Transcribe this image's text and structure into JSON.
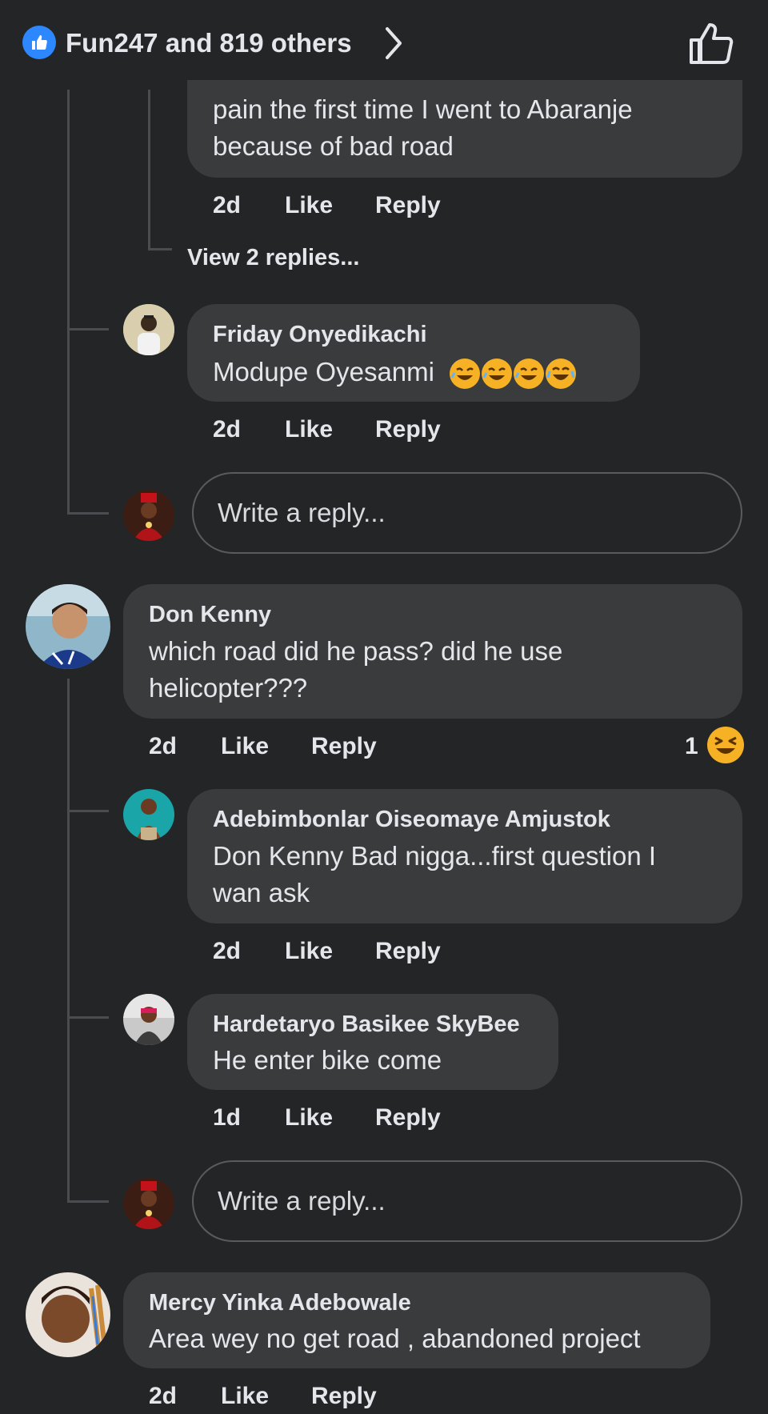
{
  "header": {
    "reactors_text": "Fun247 and 819 others",
    "like_icon": "thumbs-up-icon",
    "chevron_icon": "chevron-right-icon",
    "like_button_icon": "thumbs-up-outline-icon"
  },
  "colors": {
    "background": "#242526",
    "bubble": "#3a3b3c",
    "accent": "#2d88ff",
    "text": "#e4e6eb"
  },
  "partial_comment": {
    "text": "pain the first time I went to Abaranje because of bad road",
    "time": "2d",
    "like": "Like",
    "reply": "Reply",
    "view_replies": "View 2 replies..."
  },
  "reply_friday": {
    "name": "Friday Onyedikachi",
    "text": "Modupe Oyesanmi",
    "emojis": [
      "rolling-laughing-emoji",
      "rolling-laughing-emoji",
      "rolling-laughing-emoji",
      "tears-of-joy-emoji"
    ],
    "time": "2d",
    "like": "Like",
    "reply": "Reply"
  },
  "reply_box_1": {
    "placeholder": "Write a reply..."
  },
  "comment_don": {
    "name": "Don Kenny",
    "text": "which road did he pass? did he use helicopter???",
    "time": "2d",
    "like": "Like",
    "reply": "Reply",
    "reaction_count": "1",
    "reaction_icon": "laughing-emoji"
  },
  "reply_adebim": {
    "name": "Adebimbonlar Oiseomaye Amjustok",
    "text": "Don Kenny Bad nigga...first question I wan ask",
    "time": "2d",
    "like": "Like",
    "reply": "Reply"
  },
  "reply_hardet": {
    "name": "Hardetaryo Basikee SkyBee",
    "text": "He enter bike come",
    "time": "1d",
    "like": "Like",
    "reply": "Reply"
  },
  "reply_box_2": {
    "placeholder": "Write a reply..."
  },
  "comment_mercy": {
    "name": "Mercy Yinka Adebowale",
    "text": "Area wey no get road , abandoned project",
    "time": "2d",
    "like": "Like",
    "reply": "Reply"
  }
}
